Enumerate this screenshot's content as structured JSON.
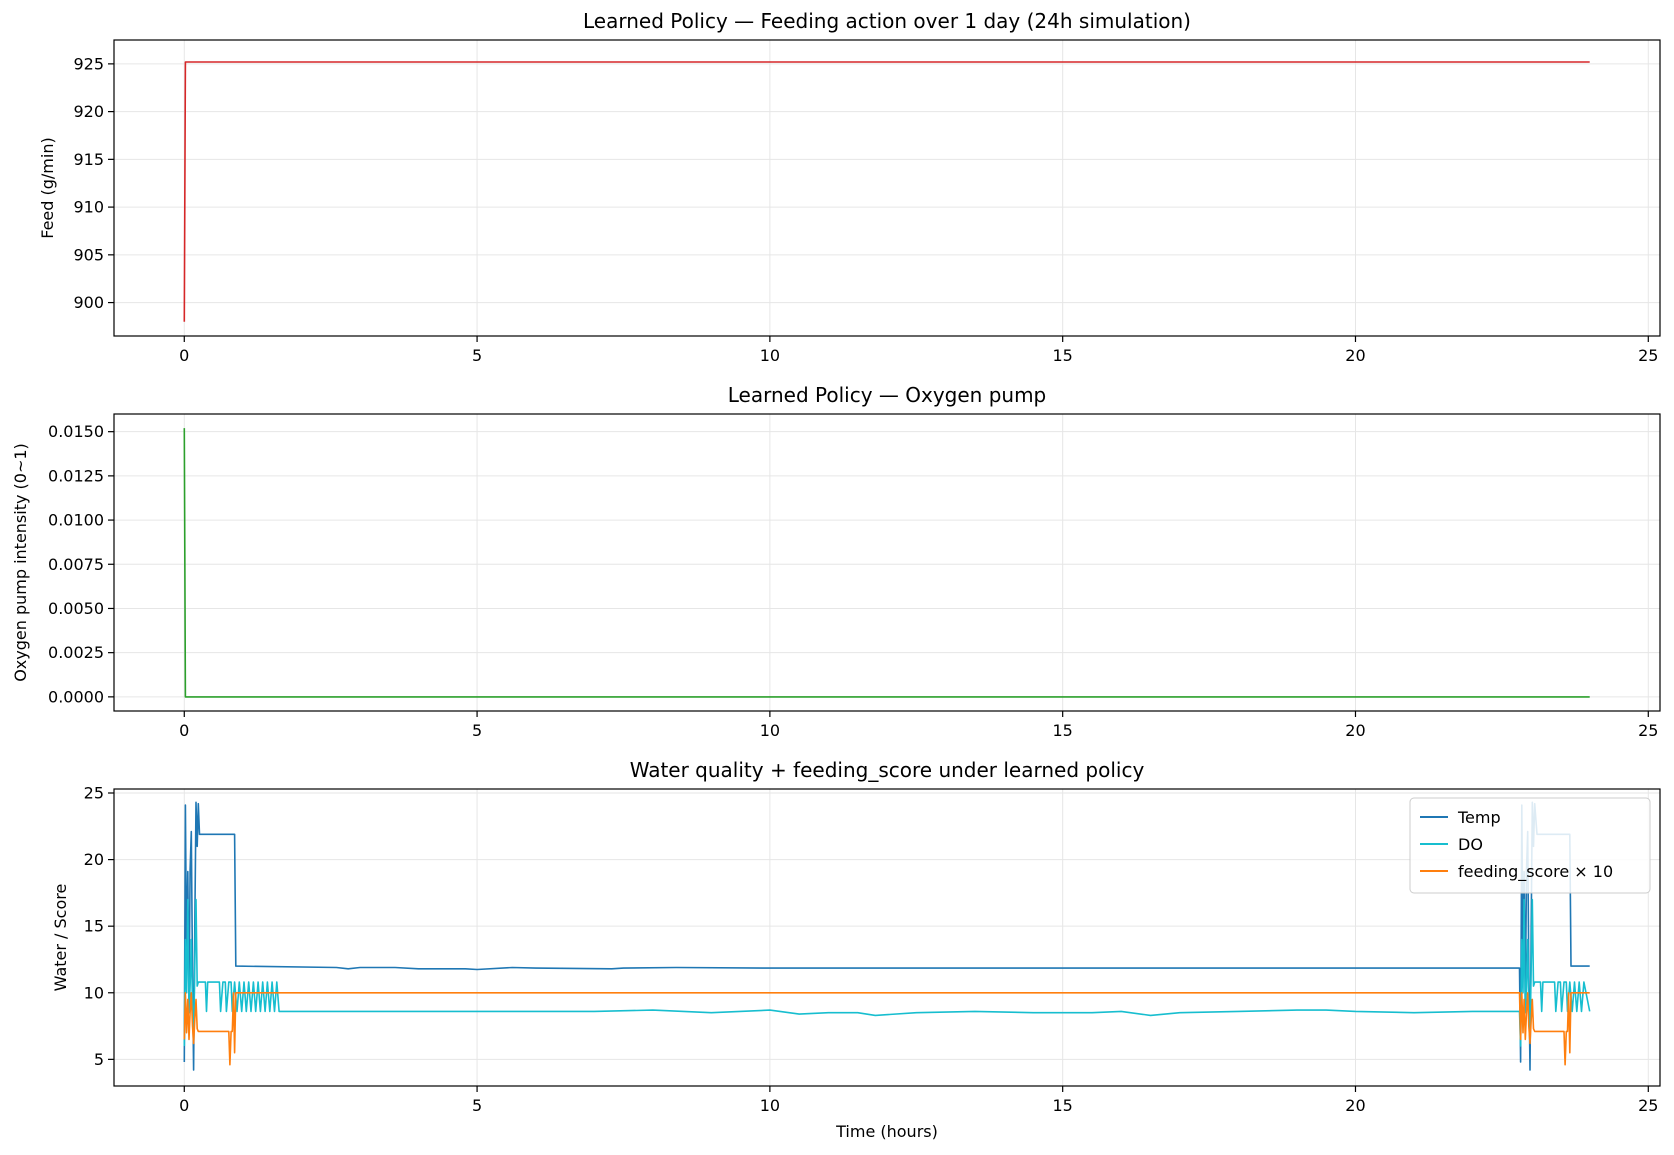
{
  "chart_data": [
    {
      "type": "line",
      "title": "Learned Policy — Feeding action over 1 day (24h simulation)",
      "xlabel": "",
      "ylabel": "Feed (g/min)",
      "xlim": [
        -1.2,
        25.2
      ],
      "ylim": [
        896.5,
        927.5
      ],
      "xticks": [
        0,
        5,
        10,
        15,
        20,
        25
      ],
      "yticks": [
        900,
        905,
        910,
        915,
        920,
        925
      ],
      "grid": true,
      "series": [
        {
          "color": "#d62728",
          "x": [
            0,
            0.02,
            24
          ],
          "y": [
            898,
            925.2,
            925.2
          ]
        }
      ]
    },
    {
      "type": "line",
      "title": "Learned Policy — Oxygen pump",
      "xlabel": "",
      "ylabel": "Oxygen pump intensity (0~1)",
      "xlim": [
        -1.2,
        25.2
      ],
      "ylim": [
        -0.0008,
        0.016
      ],
      "xticks": [
        0,
        5,
        10,
        15,
        20,
        25
      ],
      "yticks": [
        "0.0000",
        "0.0025",
        "0.0050",
        "0.0075",
        "0.0100",
        "0.0125",
        "0.0150"
      ],
      "grid": true,
      "series": [
        {
          "color": "#2ca02c",
          "x": [
            0,
            0.02,
            24
          ],
          "y": [
            0.0152,
            0,
            0
          ]
        }
      ]
    },
    {
      "type": "line",
      "title": "Water quality + feeding_score under learned policy",
      "xlabel": "Time (hours)",
      "ylabel": "Water / Score",
      "xlim": [
        -1.2,
        25.2
      ],
      "ylim": [
        3.0,
        25.3
      ],
      "xticks": [
        0,
        5,
        10,
        15,
        20,
        25
      ],
      "yticks": [
        5,
        10,
        15,
        20,
        25
      ],
      "grid": true,
      "legend": "top-right",
      "series": [
        {
          "name": "Temp",
          "color": "#1f77b4",
          "x": [
            0,
            0.02,
            0.04,
            0.06,
            0.08,
            0.1,
            0.12,
            0.14,
            0.16,
            0.18,
            0.2,
            0.22,
            0.24,
            0.26,
            0.3,
            0.86,
            0.88,
            2.6,
            2.8,
            3.0,
            3.6,
            4.0,
            4.8,
            5.0,
            5.6,
            6.0,
            7.3,
            7.5,
            8.4,
            10.0,
            15.0,
            20.0,
            22.8,
            22.82,
            22.84,
            22.86,
            22.88,
            22.9,
            22.92,
            22.94,
            22.96,
            22.98,
            23.0,
            23.02,
            23.04,
            23.06,
            23.1,
            23.66,
            23.68,
            24.0
          ],
          "y": [
            4.8,
            24.1,
            12.0,
            19.1,
            9.0,
            19.2,
            22.1,
            11.5,
            4.2,
            15.0,
            24.3,
            21.0,
            24.2,
            21.9,
            21.9,
            21.9,
            12.0,
            11.9,
            11.8,
            11.9,
            11.9,
            11.8,
            11.8,
            11.75,
            11.9,
            11.85,
            11.8,
            11.85,
            11.9,
            11.85,
            11.85,
            11.85,
            11.85,
            4.8,
            24.1,
            12.0,
            19.1,
            9.0,
            19.2,
            22.1,
            11.5,
            4.2,
            15.0,
            24.3,
            21.0,
            24.2,
            21.9,
            21.9,
            12.0,
            12.0
          ]
        },
        {
          "name": "DO",
          "color": "#17becf",
          "x": [
            0,
            0.02,
            0.04,
            0.06,
            0.08,
            0.1,
            0.12,
            0.14,
            0.16,
            0.18,
            0.2,
            0.22,
            0.24,
            0.26,
            0.28,
            0.3,
            0.32,
            0.34,
            0.36,
            0.38,
            0.4,
            0.5,
            0.6,
            0.62,
            0.66,
            0.7,
            0.72,
            0.76,
            0.8,
            0.82,
            0.86,
            0.9,
            0.94,
            0.98,
            1.02,
            1.06,
            1.1,
            1.14,
            1.18,
            1.22,
            1.26,
            1.3,
            1.34,
            1.38,
            1.42,
            1.46,
            1.5,
            1.54,
            1.58,
            1.62,
            2.0,
            3.0,
            4.0,
            5.0,
            6.0,
            7.0,
            8.0,
            9.0,
            10.0,
            10.5,
            11.0,
            11.5,
            11.8,
            12.5,
            13.5,
            14.5,
            15.5,
            16.0,
            16.5,
            17.0,
            18.0,
            19.0,
            19.5,
            20.0,
            21.0,
            22.0,
            22.8,
            22.82,
            22.84,
            22.86,
            22.88,
            22.9,
            22.92,
            22.94,
            22.96,
            22.98,
            23.0,
            23.02,
            23.04,
            23.06,
            23.08,
            23.1,
            23.12,
            23.14,
            23.16,
            23.18,
            23.2,
            23.3,
            23.4,
            23.42,
            23.46,
            23.5,
            23.52,
            23.56,
            23.6,
            23.62,
            23.66,
            23.7,
            23.74,
            23.78,
            23.82,
            23.86,
            23.9,
            24.0
          ],
          "y": [
            6.0,
            14.0,
            10.0,
            17.0,
            8.5,
            10.5,
            14.0,
            9.0,
            6.5,
            12.0,
            17.0,
            10.5,
            10.8,
            10.8,
            10.8,
            10.8,
            10.8,
            10.8,
            10.8,
            8.6,
            10.8,
            10.8,
            10.8,
            8.6,
            10.8,
            10.8,
            8.6,
            10.8,
            10.8,
            8.6,
            10.8,
            8.6,
            10.8,
            8.6,
            10.8,
            8.6,
            10.8,
            8.6,
            10.8,
            8.6,
            10.8,
            8.6,
            10.8,
            8.6,
            10.8,
            8.6,
            10.8,
            8.6,
            10.8,
            8.6,
            8.6,
            8.6,
            8.6,
            8.6,
            8.6,
            8.6,
            8.7,
            8.5,
            8.7,
            8.4,
            8.5,
            8.5,
            8.3,
            8.5,
            8.6,
            8.5,
            8.5,
            8.6,
            8.3,
            8.5,
            8.6,
            8.7,
            8.7,
            8.6,
            8.5,
            8.6,
            8.6,
            6.0,
            14.0,
            10.0,
            17.0,
            8.5,
            10.5,
            14.0,
            9.0,
            6.5,
            12.0,
            17.0,
            10.5,
            10.8,
            10.8,
            10.8,
            10.8,
            10.8,
            10.8,
            8.6,
            10.8,
            10.8,
            10.8,
            8.6,
            10.8,
            10.8,
            8.6,
            10.8,
            10.8,
            8.6,
            10.8,
            8.6,
            10.8,
            8.6,
            10.8,
            8.6,
            10.8,
            8.6
          ]
        },
        {
          "name": "feeding_score × 10",
          "color": "#ff7f0e",
          "x": [
            0,
            0.02,
            0.04,
            0.06,
            0.08,
            0.1,
            0.12,
            0.14,
            0.16,
            0.18,
            0.2,
            0.22,
            0.24,
            0.26,
            0.3,
            0.4,
            0.6,
            0.76,
            0.78,
            0.8,
            0.82,
            0.84,
            0.86,
            0.88,
            0.9,
            1.0,
            5.0,
            10.0,
            15.0,
            20.0,
            22.8,
            22.82,
            22.84,
            22.86,
            22.88,
            22.9,
            22.92,
            22.94,
            22.96,
            22.98,
            23.0,
            23.02,
            23.04,
            23.06,
            23.1,
            23.2,
            23.4,
            23.56,
            23.58,
            23.6,
            23.62,
            23.64,
            23.66,
            23.68,
            23.7,
            24.0
          ],
          "y": [
            6.5,
            10.0,
            7.0,
            9.5,
            6.5,
            8.5,
            10.0,
            7.5,
            6.2,
            8.0,
            9.5,
            7.3,
            7.1,
            7.1,
            7.1,
            7.1,
            7.1,
            7.1,
            4.6,
            7.1,
            7.1,
            10.0,
            5.5,
            10.0,
            10.0,
            10.0,
            10.0,
            10.0,
            10.0,
            10.0,
            10.0,
            6.5,
            10.0,
            7.0,
            9.5,
            6.5,
            8.5,
            10.0,
            7.5,
            6.2,
            8.0,
            9.5,
            7.3,
            7.1,
            7.1,
            7.1,
            7.1,
            7.1,
            4.6,
            7.1,
            7.1,
            10.0,
            5.5,
            10.0,
            10.0,
            10.0
          ]
        }
      ]
    }
  ]
}
